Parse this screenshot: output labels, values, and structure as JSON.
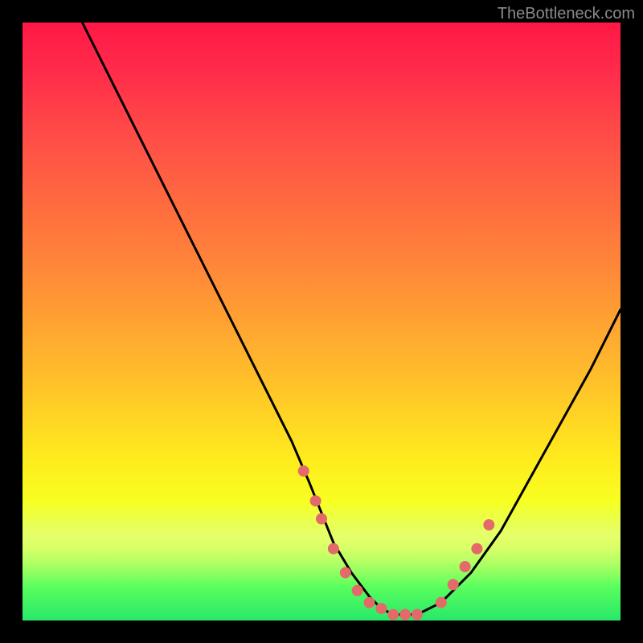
{
  "watermark": "TheBottleneck.com",
  "chart_data": {
    "type": "line",
    "title": "",
    "xlabel": "",
    "ylabel": "",
    "xlim": [
      0,
      100
    ],
    "ylim": [
      0,
      100
    ],
    "grid": false,
    "legend": false,
    "series": [
      {
        "name": "curve",
        "color": "#000000",
        "x": [
          10,
          15,
          20,
          25,
          30,
          35,
          40,
          45,
          48,
          50,
          52,
          55,
          58,
          60,
          62,
          64,
          66,
          70,
          75,
          80,
          85,
          90,
          95,
          100
        ],
        "y": [
          100,
          90,
          80,
          70,
          60,
          50,
          40,
          30,
          23,
          18,
          13,
          8,
          4,
          2,
          1,
          1,
          1,
          3,
          8,
          15,
          24,
          33,
          42,
          52
        ]
      },
      {
        "name": "markers",
        "color": "#e46a6a",
        "type": "scatter",
        "x": [
          47,
          49,
          50,
          52,
          54,
          56,
          58,
          60,
          62,
          64,
          66,
          70,
          72,
          74,
          76,
          78
        ],
        "y": [
          25,
          20,
          17,
          12,
          8,
          5,
          3,
          2,
          1,
          1,
          1,
          3,
          6,
          9,
          12,
          16
        ]
      }
    ],
    "background_gradient": {
      "stops": [
        {
          "pos": 0.0,
          "color": "#ff1846"
        },
        {
          "pos": 0.3,
          "color": "#ff6a40"
        },
        {
          "pos": 0.6,
          "color": "#ffd028"
        },
        {
          "pos": 0.8,
          "color": "#f8ff20"
        },
        {
          "pos": 1.0,
          "color": "#28e86a"
        }
      ]
    }
  }
}
